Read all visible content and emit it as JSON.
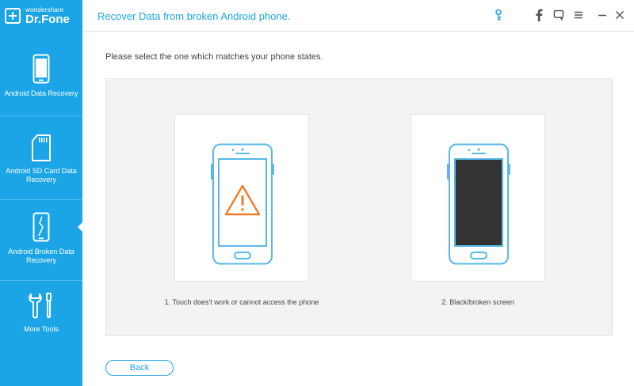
{
  "brand": {
    "small": "wondershare",
    "name": "Dr.Fone"
  },
  "header": {
    "title": "Recover Data from broken Android phone."
  },
  "sidebar": {
    "items": [
      {
        "label": "Android Data Recovery",
        "icon": "phone-icon"
      },
      {
        "label": "Android SD Card Data Recovery",
        "icon": "sd-card-icon"
      },
      {
        "label": "Android Broken Data Recovery",
        "icon": "broken-phone-icon",
        "active": true
      },
      {
        "label": "More Tools",
        "icon": "tools-icon"
      }
    ]
  },
  "toolbar": {
    "icons": [
      "key-icon",
      "facebook-icon",
      "feedback-icon",
      "menu-icon",
      "minimize-icon",
      "close-icon"
    ]
  },
  "main": {
    "instruction": "Please select the one which matches your phone states.",
    "options": [
      {
        "label": "1. Touch does't work or cannot access the phone",
        "icon": "warning-phone-icon"
      },
      {
        "label": "2. Black/broken screen",
        "icon": "black-screen-phone-icon"
      }
    ],
    "back_label": "Back"
  },
  "colors": {
    "accent": "#1ba5e6",
    "warning": "#f07b2b",
    "screen_dark": "#333333"
  }
}
